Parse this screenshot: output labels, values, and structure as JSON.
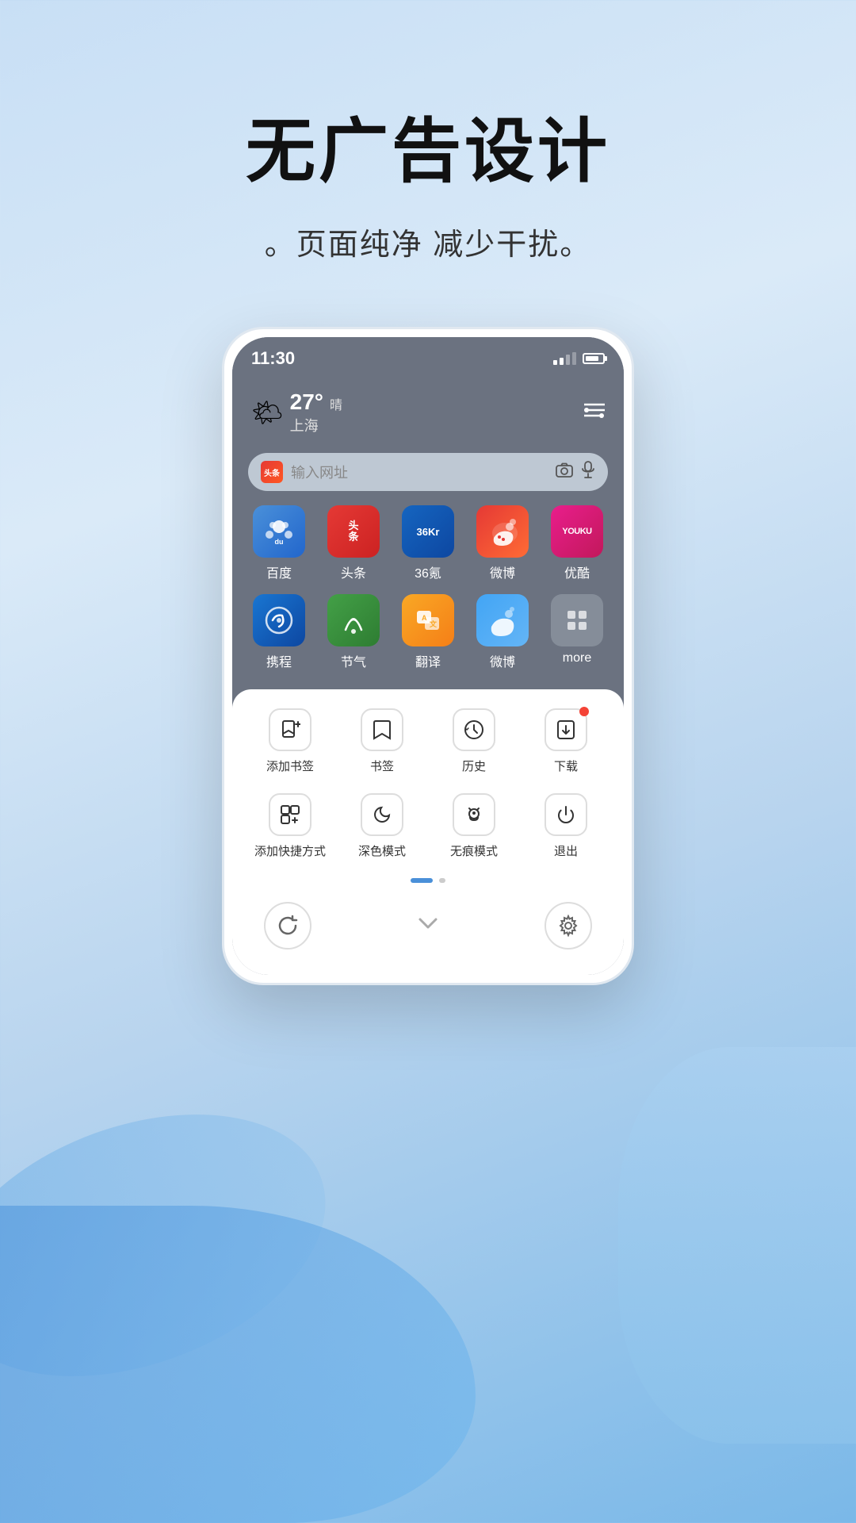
{
  "headline": "无广告设计",
  "subtitle": "。页面纯净 减少干扰。",
  "statusBar": {
    "time": "11:30",
    "signal": "signal",
    "battery": "battery"
  },
  "weather": {
    "icon": "🌤",
    "temp": "27°",
    "label": "晴",
    "city": "上海"
  },
  "searchBar": {
    "logoText": "头条",
    "placeholder": "输入网址",
    "cameraIcon": "📷",
    "micIcon": "🎤"
  },
  "apps": [
    {
      "name": "百度",
      "iconClass": "icon-baidu",
      "iconText": "du"
    },
    {
      "name": "头条",
      "iconClass": "icon-toutiao",
      "iconText": "头条"
    },
    {
      "name": "36氪",
      "iconClass": "icon-36kr",
      "iconText": "36Kr"
    },
    {
      "name": "微博",
      "iconClass": "icon-weibo",
      "iconText": "微博"
    },
    {
      "name": "优酷",
      "iconClass": "icon-youku",
      "iconText": "YOUKU"
    },
    {
      "name": "携程",
      "iconClass": "icon-xiecheng",
      "iconText": "携程"
    },
    {
      "name": "节气",
      "iconClass": "icon-jieqi",
      "iconText": "节气"
    },
    {
      "name": "翻译",
      "iconClass": "icon-fanyi",
      "iconText": "翻译"
    },
    {
      "name": "微博",
      "iconClass": "icon-weibo2",
      "iconText": "微博"
    },
    {
      "name": "more",
      "iconClass": "icon-more",
      "iconText": "···"
    }
  ],
  "bottomMenu": {
    "row1": [
      {
        "icon": "bookmark-add",
        "label": "添加书签",
        "badge": false
      },
      {
        "icon": "bookmark",
        "label": "书签",
        "badge": false
      },
      {
        "icon": "history",
        "label": "历史",
        "badge": false
      },
      {
        "icon": "download",
        "label": "下载",
        "badge": true
      }
    ],
    "row2": [
      {
        "icon": "shortcut-add",
        "label": "添加快捷方式",
        "badge": false
      },
      {
        "icon": "moon",
        "label": "深色模式",
        "badge": false
      },
      {
        "icon": "ghost",
        "label": "无痕模式",
        "badge": false
      },
      {
        "icon": "power",
        "label": "退出",
        "badge": false
      }
    ]
  },
  "bottomBar": {
    "refreshIcon": "↺",
    "chevron": "⌄",
    "settingsIcon": "⚙"
  }
}
